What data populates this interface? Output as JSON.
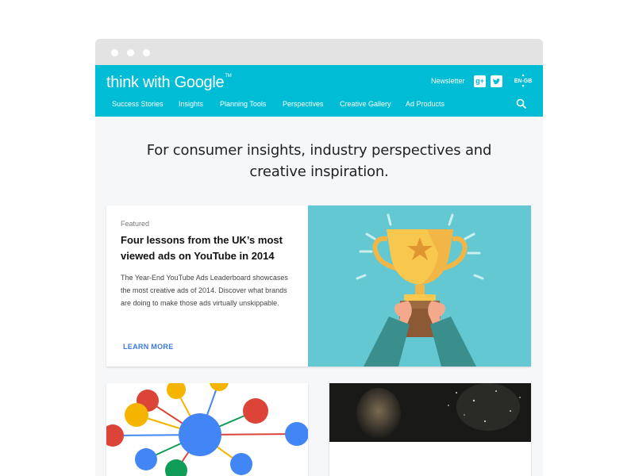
{
  "header": {
    "logo": {
      "part1": "think",
      "part2": "with",
      "part3": "Google",
      "tm": "TM"
    },
    "newsletter": "Newsletter",
    "social": [
      {
        "label": "g+",
        "name": "google-plus-icon"
      },
      {
        "label": "t",
        "name": "twitter-icon"
      }
    ],
    "lang": {
      "top": "EN",
      "bottom": "GB"
    }
  },
  "nav": {
    "items": [
      "Success Stories",
      "Insights",
      "Planning Tools",
      "Perspectives",
      "Creative Gallery",
      "Ad Products"
    ]
  },
  "main": {
    "tagline_line1": "For consumer insights, industry perspectives and",
    "tagline_line2": "creative inspiration.",
    "featured": {
      "kicker": "Featured",
      "title": "Four lessons from the UK’s most viewed ads on YouTube in 2014",
      "description": "The Year-End YouTube Ads Leaderboard showcases the most creative ads of 2014. Discover what brands are doing to make those ads virtually unskippable.",
      "cta": "LEARN MORE"
    }
  },
  "colors": {
    "brand": "#00bcd4",
    "page_bg": "#f5f7f9",
    "featured_art_bg": "#64c8d2",
    "link": "#3b78e7",
    "google_blue": "#4285f4",
    "google_red": "#db4437",
    "google_yellow": "#f4b400",
    "google_green": "#0f9d58"
  }
}
